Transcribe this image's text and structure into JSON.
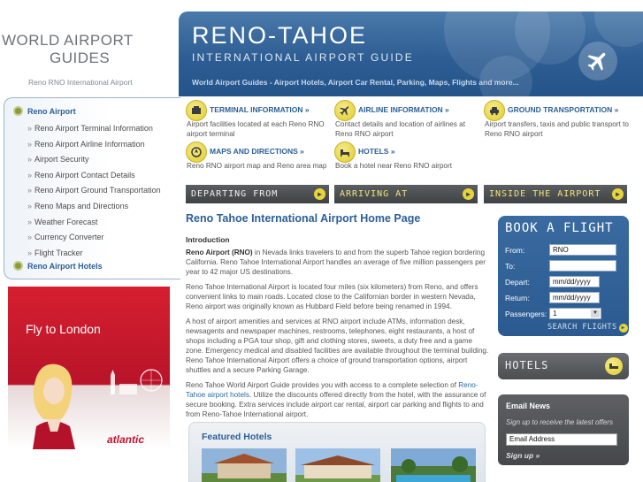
{
  "logo": {
    "line1": "WORLD AIRPORT",
    "line2": "GUIDES",
    "subtitle": "Reno RNO International Airport"
  },
  "banner": {
    "title": "RENO-TAHOE",
    "subtitle": "INTERNATIONAL AIRPORT GUIDE",
    "tagline": "World Airport Guides - Airport Hotels, Airport Car Rental, Parking, Maps, Flights and more..."
  },
  "nav": {
    "top": "Reno Airport",
    "items": [
      "Reno Airport Terminal Information",
      "Reno Airport Airline Information",
      "Airport Security",
      "Reno Airport Contact Details",
      "Reno Airport Ground Transportation",
      "Reno Maps and Directions",
      "Weather Forecast",
      "Currency Converter",
      "Flight Tracker"
    ],
    "bottom": "Reno Airport Hotels"
  },
  "ad": {
    "headline": "Fly to London",
    "brand": "atlantic"
  },
  "tiles": [
    {
      "head": "TERMINAL INFORMATION »",
      "desc": "Airport facilities located at each Reno RNO airport terminal",
      "icon": "terminal-icon"
    },
    {
      "head": "AIRLINE INFORMATION »",
      "desc": "Contact details and location of airlines at Reno RNO airport",
      "icon": "airline-plane-icon"
    },
    {
      "head": "GROUND TRANSPORTATION »",
      "desc": "Airport transfers, taxis and public transport to Reno RNO airport",
      "icon": "car-icon"
    },
    {
      "head": "MAPS AND DIRECTIONS »",
      "desc": "Reno RNO airport map and Reno area map",
      "icon": "map-icon"
    },
    {
      "head": "HOTELS »",
      "desc": "Book a hotel near Reno RNO airport",
      "icon": "bed-icon"
    }
  ],
  "strips": {
    "departing": "DEPARTING FROM",
    "arriving": "ARRIVING AT",
    "inside": "INSIDE THE AIRPORT"
  },
  "main": {
    "title": "Reno Tahoe International Airport Home Page",
    "intro_heading": "Introduction",
    "p1_bold": "Reno Airport (RNO)",
    "p1_rest": " in Nevada links travelers to and from the superb Tahoe region bordering California. Reno Tahoe International Airport handles an average of five million passengers per year to 42 major US destinations.",
    "p2": "Reno Tahoe International Airport is located four miles (six kilometers) from Reno, and offers convenient links to main roads. Located close to the Californian border in western Nevada, Reno airport was originally known as Hubbard Field before being renamed in 1994.",
    "p3": "A host of airport amenities and services at RNO airport include ATMs, information desk, newsagents and newspaper machines, restrooms, telephones, eight restaurants, a host of shops including a PGA tour shop, gift and clothing stores, sweets, a duty free and a game zone. Emergency medical and disabled facilities are available throughout the terminal building. Reno Tahoe International Airport offers a choice of ground transportation options, airport shuttles and a secure Parking Garage.",
    "p4_a": "Reno Tahoe World Airport Guide provides you with access to a complete selection of ",
    "p4_link": "Reno-Tahoe airport hotels",
    "p4_b": ". Utilize the discounts offered directly from the hotel, with the assurance of secure booking. Extra services include airport car rental, airport car parking and flights to and from Reno-Tahoe International airport."
  },
  "featured": {
    "title": "Featured Hotels"
  },
  "book": {
    "title": "BOOK A FLIGHT",
    "from_label": "From:",
    "from_value": "RNO",
    "to_label": "To:",
    "to_value": "",
    "depart_label": "Depart:",
    "depart_value": "mm/dd/yyyy",
    "return_label": "Return:",
    "return_value": "mm/dd/yyyy",
    "passengers_label": "Passengers:",
    "passengers_value": "1",
    "search_label": "SEARCH FLIGHTS"
  },
  "hotels_box": {
    "title": "HOTELS"
  },
  "email": {
    "title": "Email News",
    "desc": "Sign up to receive the latest offers",
    "input_value": "Email Address",
    "signup": "Sign up »"
  }
}
